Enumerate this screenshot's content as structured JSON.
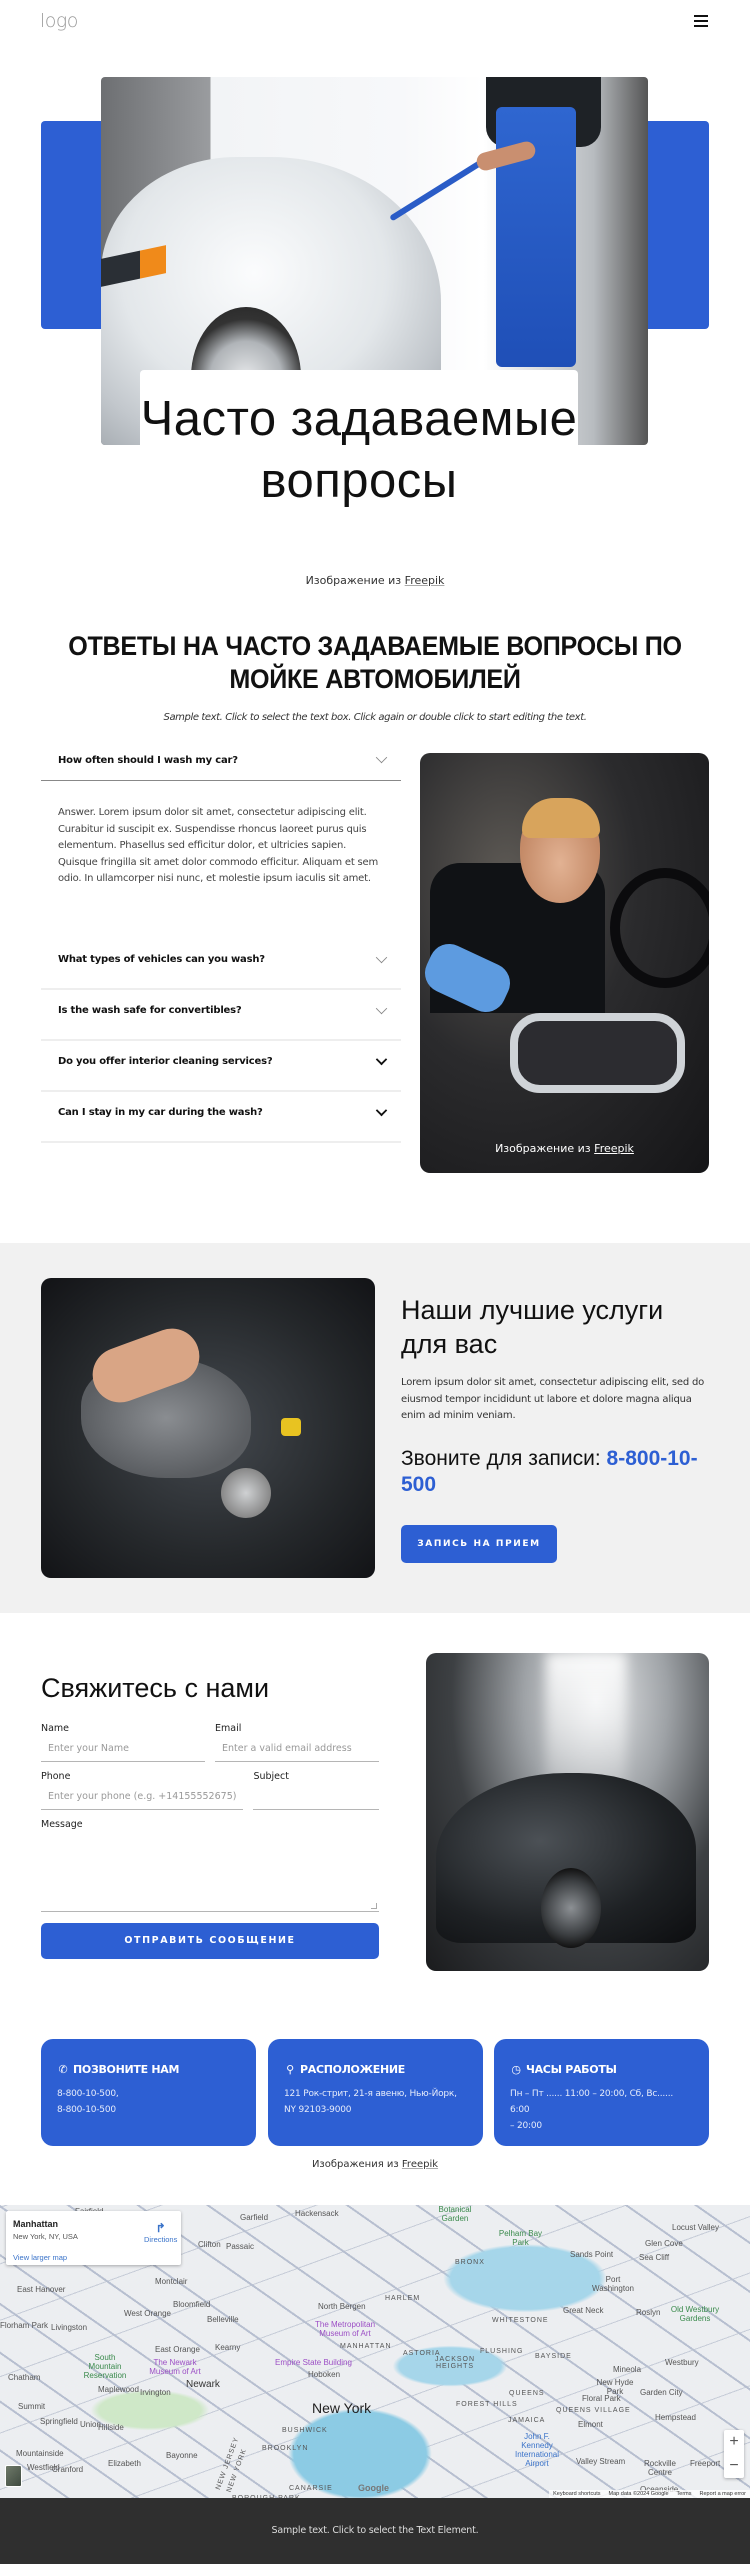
{
  "header": {
    "logo": "logo",
    "menu_icon": "hamburger-menu-icon"
  },
  "hero": {
    "title": "Часто задаваемые вопросы",
    "credit_prefix": "Изображение из",
    "credit_link": "Freepik"
  },
  "faq": {
    "heading": "ОТВЕТЫ НА ЧАСТО ЗАДАВАЕМЫЕ ВОПРОСЫ ПО МОЙКЕ АВТОМОБИЛЕЙ",
    "sample_text": "Sample text. Click to select the text box. Click again or double click to start editing the text.",
    "items": [
      {
        "question": "How often should I wash my car?",
        "expanded": true,
        "answer": "Answer. Lorem ipsum dolor sit amet, consectetur adipiscing elit. Curabitur id suscipit ex. Suspendisse rhoncus laoreet purus quis elementum. Phasellus sed efficitur dolor, et ultricies sapien. Quisque fringilla sit amet dolor commodo efficitur. Aliquam et sem odio. In ullamcorper nisi nunc, et molestie ipsum iaculis sit amet."
      },
      {
        "question": "What types of vehicles can you wash?",
        "expanded": false
      },
      {
        "question": "Is the wash safe for convertibles?",
        "expanded": false
      },
      {
        "question": "Do you offer interior cleaning services?",
        "expanded": false
      },
      {
        "question": "Can I stay in my car during the wash?",
        "expanded": false
      }
    ],
    "photo_credit_prefix": "Изображение из",
    "photo_credit_link": "Freepik"
  },
  "services": {
    "heading": "Наши лучшие услуги для вас",
    "text": "Lorem ipsum dolor sit amet, consectetur adipiscing elit, sed do eiusmod tempor incididunt ut labore et dolore magna aliqua enim ad minim veniam.",
    "call_label": "Звоните для записи:",
    "call_phone": "8-800-10-500",
    "button": "ЗАПИСЬ НА ПРИЕМ"
  },
  "contact": {
    "heading": "Свяжитесь с нами",
    "fields": {
      "name": {
        "label": "Name",
        "placeholder": "Enter your Name"
      },
      "email": {
        "label": "Email",
        "placeholder": "Enter a valid email address"
      },
      "phone": {
        "label": "Phone",
        "placeholder": "Enter your phone (e.g. +14155552675)"
      },
      "subject": {
        "label": "Subject",
        "placeholder": ""
      },
      "message": {
        "label": "Message",
        "placeholder": ""
      }
    },
    "submit": "ОТПРАВИТЬ СООБЩЕНИЕ"
  },
  "cards": [
    {
      "icon": "phone-icon",
      "glyph": "✆",
      "title": "ПОЗВОНИТЕ НАМ",
      "lines": [
        "8-800-10-500,",
        "8-800-10-500"
      ]
    },
    {
      "icon": "location-pin-icon",
      "glyph": "⚲",
      "title": "РАСПОЛОЖЕНИЕ",
      "lines": [
        "121 Рок-стрит, 21-я авеню, Нью-Йорк,",
        "NY 92103-9000"
      ]
    },
    {
      "icon": "clock-icon",
      "glyph": "◷",
      "title": "ЧАСЫ РАБОТЫ",
      "lines": [
        "Пн – Пт ...... 11:00 – 20:00, Сб, Вс...... 6:00",
        "– 20:00"
      ]
    }
  ],
  "cards_credit": {
    "prefix": "Изображения из",
    "link": "Freepik"
  },
  "map": {
    "place": "Manhattan",
    "address": "New York, NY, USA",
    "view_larger": "View larger map",
    "directions": "Directions",
    "zoom_in": "+",
    "zoom_out": "−",
    "google": "Google",
    "attribution": [
      "Keyboard shortcuts",
      "Map data ©2024 Google",
      "Terms",
      "Report a map error"
    ],
    "labels": {
      "fairfield": "Fairfield",
      "garfield": "Garfield",
      "hackensack": "Hackensack",
      "clifton": "Clifton",
      "passaic": "Passaic",
      "montclair": "Montclair",
      "east_hanover": "East Hanover",
      "bloomfield": "Bloomfield",
      "west_orange": "West Orange",
      "belleville": "Belleville",
      "north_bergen": "North Bergen",
      "florham_park": "Florham Park",
      "livingston": "Livingston",
      "met_museum": "The Metropolitan Museum of Art",
      "manhattan": "MANHATTAN",
      "east_orange": "East Orange",
      "kearny": "Kearny",
      "south_mountain": "South Mountain Reservation",
      "newark_museum": "The Newark Museum of Art",
      "empire_state": "Empire State Building",
      "hoboken": "Hoboken",
      "chatham": "Chatham",
      "newark": "Newark",
      "maplewood": "Maplewood",
      "irvington": "Irvington",
      "new_york": "New York",
      "summit": "Summit",
      "springfield": "Springfield",
      "union": "Union",
      "hillside": "Hillside",
      "mountainside": "Mountainside",
      "westfield": "Westfield",
      "cranford": "Cranford",
      "elizabeth": "Elizabeth",
      "bayonne": "Bayonne",
      "brooklyn": "BROOKLYN",
      "bushwick": "BUSHWICK",
      "canarsie": "CANARSIE",
      "queens": "QUEENS",
      "forest_hills": "FOREST HILLS",
      "jamaica": "JAMAICA",
      "jfk": "John F. Kennedy International Airport",
      "valley_stream": "Valley Stream",
      "rockville": "Rockville Centre",
      "freeport": "Freeport",
      "oceanside": "Oceanside",
      "hempstead": "Hempstead",
      "garden_city": "Garden City",
      "floral_park": "Floral Park",
      "new_hyde_park": "New Hyde Park",
      "elmont": "Elmont",
      "queens_village": "QUEENS VILLAGE",
      "mineola": "Mineola",
      "westbury": "Westbury",
      "old_westbury": "Old Westbury Gardens",
      "roslyn": "Roslyn",
      "great_neck": "Great Neck",
      "port_washington": "Port Washington",
      "sands_point": "Sands Point",
      "sea_cliff": "Sea Cliff",
      "glen_cove": "Glen Cove",
      "locust_valley": "Locust Valley",
      "pelham": "Pelham Bay Park",
      "bronx": "BRONX",
      "botanical": "Botanical Garden",
      "harlem": "HARLEM",
      "whitestone": "WHITESTONE",
      "flushing": "FLUSHING",
      "bayside": "BAYSIDE",
      "astoria": "ASTORIA",
      "jackson_heights": "JACKSON HEIGHTS",
      "nj": "NEW JERSEY",
      "ny": "NEW YORK",
      "borough_park": "BOROUGH PARK"
    }
  },
  "footer": {
    "text": "Sample text. Click to select the Text Element."
  }
}
